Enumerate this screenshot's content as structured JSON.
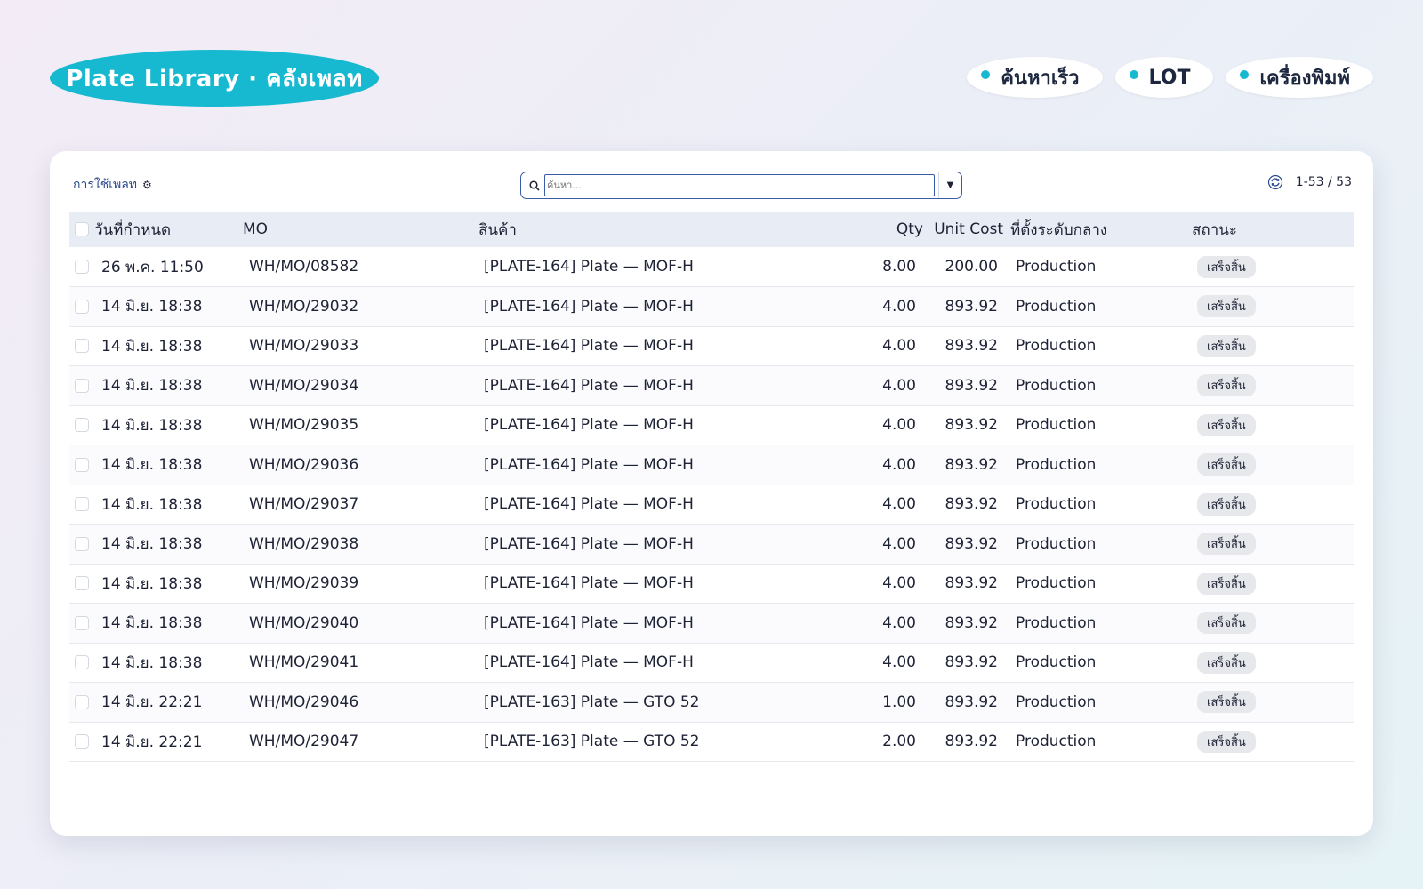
{
  "header": {
    "title": "Plate Library · คลังเพลท"
  },
  "top_actions": [
    {
      "label": "ค้นหาเร็ว"
    },
    {
      "label": "LOT"
    },
    {
      "label": "เครื่องพิมพ์"
    }
  ],
  "toolbar": {
    "breadcrumb": "การใช้เพลท",
    "search_placeholder": "ค้นหา...",
    "pager_text": "1-53 / 53"
  },
  "table": {
    "headers": {
      "date": "วันที่กำหนด",
      "mo": "MO",
      "product": "สินค้า",
      "qty": "Qty",
      "unit_cost": "Unit Cost",
      "location": "ที่ตั้งระดับกลาง",
      "status": "สถานะ"
    },
    "rows": [
      {
        "date": "26 พ.ค. 11:50",
        "mo": "WH/MO/08582",
        "product": "[PLATE-164] Plate — MOF-H",
        "qty": "8.00",
        "unit_cost": "200.00",
        "location": "Production",
        "status": "เสร็จสิ้น"
      },
      {
        "date": "14 มิ.ย. 18:38",
        "mo": "WH/MO/29032",
        "product": "[PLATE-164] Plate — MOF-H",
        "qty": "4.00",
        "unit_cost": "893.92",
        "location": "Production",
        "status": "เสร็จสิ้น"
      },
      {
        "date": "14 มิ.ย. 18:38",
        "mo": "WH/MO/29033",
        "product": "[PLATE-164] Plate — MOF-H",
        "qty": "4.00",
        "unit_cost": "893.92",
        "location": "Production",
        "status": "เสร็จสิ้น"
      },
      {
        "date": "14 มิ.ย. 18:38",
        "mo": "WH/MO/29034",
        "product": "[PLATE-164] Plate — MOF-H",
        "qty": "4.00",
        "unit_cost": "893.92",
        "location": "Production",
        "status": "เสร็จสิ้น"
      },
      {
        "date": "14 มิ.ย. 18:38",
        "mo": "WH/MO/29035",
        "product": "[PLATE-164] Plate — MOF-H",
        "qty": "4.00",
        "unit_cost": "893.92",
        "location": "Production",
        "status": "เสร็จสิ้น"
      },
      {
        "date": "14 มิ.ย. 18:38",
        "mo": "WH/MO/29036",
        "product": "[PLATE-164] Plate — MOF-H",
        "qty": "4.00",
        "unit_cost": "893.92",
        "location": "Production",
        "status": "เสร็จสิ้น"
      },
      {
        "date": "14 มิ.ย. 18:38",
        "mo": "WH/MO/29037",
        "product": "[PLATE-164] Plate — MOF-H",
        "qty": "4.00",
        "unit_cost": "893.92",
        "location": "Production",
        "status": "เสร็จสิ้น"
      },
      {
        "date": "14 มิ.ย. 18:38",
        "mo": "WH/MO/29038",
        "product": "[PLATE-164] Plate — MOF-H",
        "qty": "4.00",
        "unit_cost": "893.92",
        "location": "Production",
        "status": "เสร็จสิ้น"
      },
      {
        "date": "14 มิ.ย. 18:38",
        "mo": "WH/MO/29039",
        "product": "[PLATE-164] Plate — MOF-H",
        "qty": "4.00",
        "unit_cost": "893.92",
        "location": "Production",
        "status": "เสร็จสิ้น"
      },
      {
        "date": "14 มิ.ย. 18:38",
        "mo": "WH/MO/29040",
        "product": "[PLATE-164] Plate — MOF-H",
        "qty": "4.00",
        "unit_cost": "893.92",
        "location": "Production",
        "status": "เสร็จสิ้น"
      },
      {
        "date": "14 มิ.ย. 18:38",
        "mo": "WH/MO/29041",
        "product": "[PLATE-164] Plate — MOF-H",
        "qty": "4.00",
        "unit_cost": "893.92",
        "location": "Production",
        "status": "เสร็จสิ้น"
      },
      {
        "date": "14 มิ.ย. 22:21",
        "mo": "WH/MO/29046",
        "product": "[PLATE-163] Plate — GTO 52",
        "qty": "1.00",
        "unit_cost": "893.92",
        "location": "Production",
        "status": "เสร็จสิ้น"
      },
      {
        "date": "14 มิ.ย. 22:21",
        "mo": "WH/MO/29047",
        "product": "[PLATE-163] Plate — GTO 52",
        "qty": "2.00",
        "unit_cost": "893.92",
        "location": "Production",
        "status": "เสร็จสิ้น"
      }
    ]
  },
  "colors": {
    "accent": "#17b9d1",
    "link": "#2d4a8e",
    "header_row": "#e8ecf5"
  },
  "icons": {
    "settings": "gear-icon",
    "search": "search-icon",
    "dropdown": "caret-down-icon",
    "refresh": "refresh-icon"
  }
}
